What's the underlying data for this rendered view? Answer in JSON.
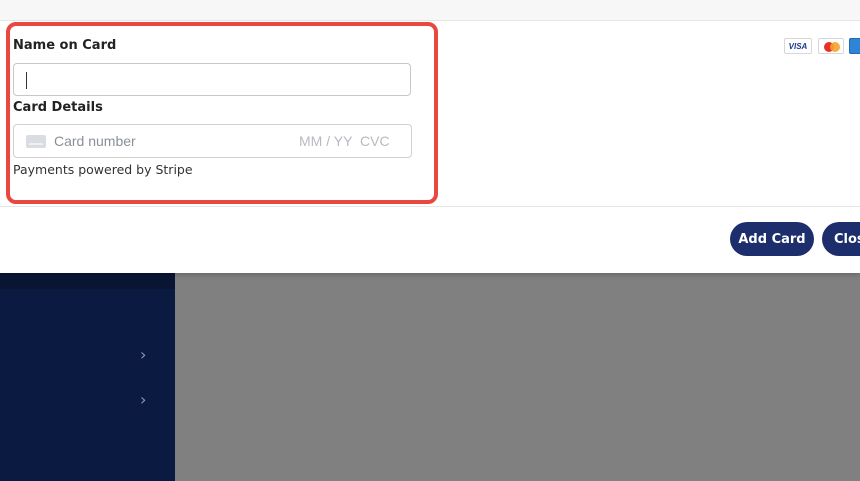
{
  "form": {
    "name_label": "Name on Card",
    "name_value": "",
    "card_details_label": "Card Details",
    "card_number_placeholder": "Card number",
    "expiry_placeholder": "MM / YY",
    "cvc_placeholder": "CVC",
    "powered_by": "Payments powered by Stripe"
  },
  "card_brands": {
    "visa": "VISA",
    "mastercard": "mastercard",
    "amex": "AMEX"
  },
  "footer": {
    "add_label": "Add Card",
    "close_label": "Close"
  },
  "colors": {
    "primary_button": "#1c2e6b",
    "highlight": "#e8483f",
    "sidebar": "#0b1a40",
    "overlay": "#808080"
  }
}
